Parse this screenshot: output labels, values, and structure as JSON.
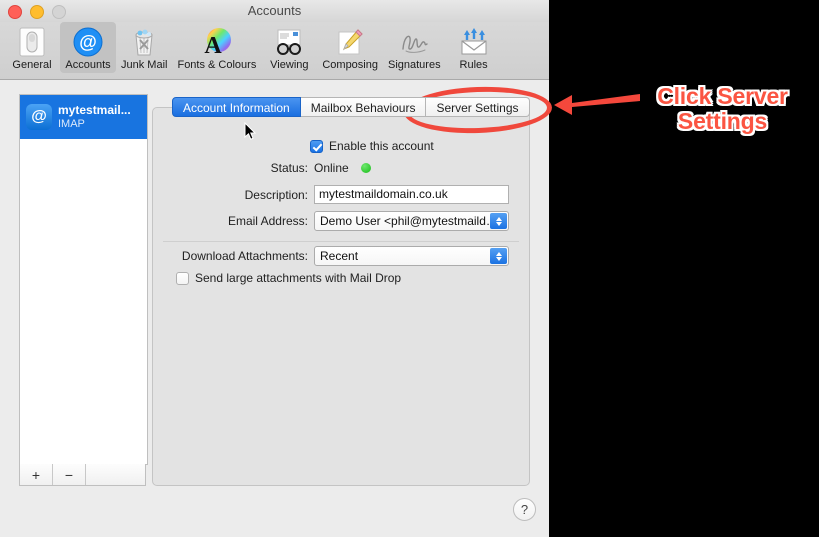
{
  "window": {
    "title": "Accounts",
    "traffic_lights": [
      "close",
      "minimize",
      "zoom"
    ]
  },
  "toolbar": {
    "items": [
      {
        "label": "General",
        "icon": "general-icon",
        "selected": false
      },
      {
        "label": "Accounts",
        "icon": "at-sign-icon",
        "selected": true
      },
      {
        "label": "Junk Mail",
        "icon": "trash-icon",
        "selected": false
      },
      {
        "label": "Fonts & Colours",
        "icon": "font-colour-icon",
        "selected": false
      },
      {
        "label": "Viewing",
        "icon": "glasses-icon",
        "selected": false
      },
      {
        "label": "Composing",
        "icon": "pencil-pad-icon",
        "selected": false
      },
      {
        "label": "Signatures",
        "icon": "signature-icon",
        "selected": false
      },
      {
        "label": "Rules",
        "icon": "rules-icon",
        "selected": false
      }
    ]
  },
  "sidebar": {
    "accounts": [
      {
        "name": "mytestmail...",
        "type": "IMAP",
        "icon": "at-sign-badge",
        "selected": true
      }
    ],
    "add_label": "+",
    "remove_label": "−"
  },
  "tabs": [
    {
      "label": "Account Information",
      "active": true
    },
    {
      "label": "Mailbox Behaviours",
      "active": false
    },
    {
      "label": "Server Settings",
      "active": false
    }
  ],
  "form": {
    "enable_account": {
      "label": "Enable this account",
      "checked": true
    },
    "status": {
      "label": "Status:",
      "value": "Online",
      "indicator": "green-dot"
    },
    "description": {
      "label": "Description:",
      "value": "mytestmaildomain.co.uk",
      "placeholder": ""
    },
    "email_address": {
      "label": "Email Address:",
      "value": "Demo User <phil@mytestmaild…"
    },
    "download_attachments": {
      "label": "Download Attachments:",
      "value": "Recent"
    },
    "mail_drop": {
      "label": "Send large attachments with Mail Drop",
      "checked": false
    }
  },
  "help": {
    "label": "?"
  },
  "annotations": {
    "callout_line1": "Click Server",
    "callout_line2": "Settings",
    "callout_color": "#fb5542",
    "ellipse_color": "#f0483c",
    "arrow_direction": "left"
  }
}
